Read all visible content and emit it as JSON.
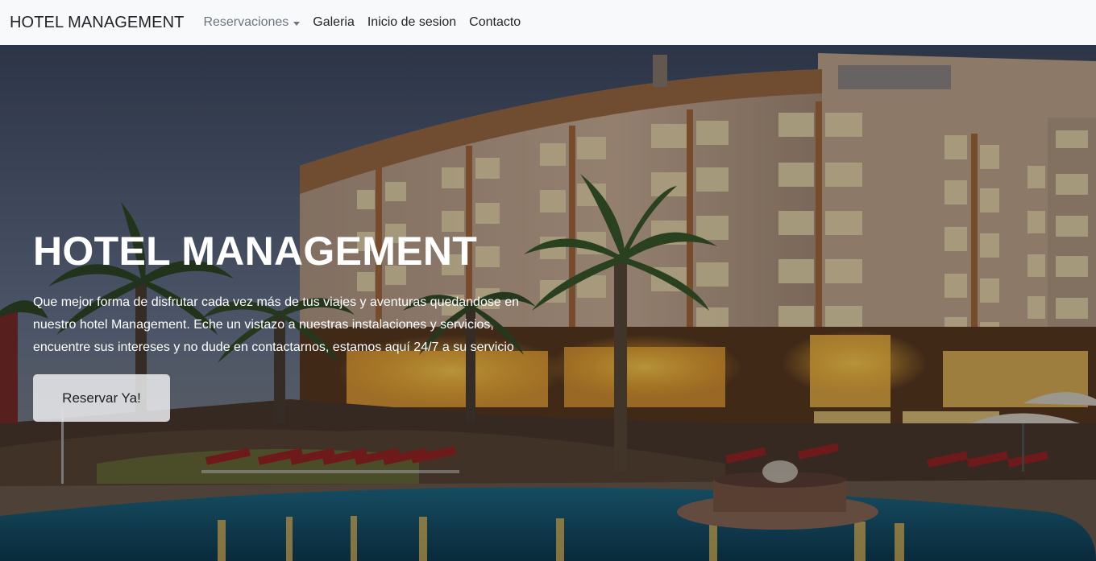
{
  "navbar": {
    "brand": "HOTEL MANAGEMENT",
    "items": [
      {
        "label": "Reservaciones",
        "dropdown": true
      },
      {
        "label": "Galeria"
      },
      {
        "label": "Inicio de sesion"
      },
      {
        "label": "Contacto"
      }
    ]
  },
  "hero": {
    "title": "HOTEL MANAGEMENT",
    "description": "Que mejor forma de disfrutar cada vez más de tus viajes y aventuras quedandose en nuestro hotel Management. Eche un vistazo a nuestras instalaciones y servicios, encuentre sus intereses y no dude en contactarnos, estamos aquí 24/7 a su servicio",
    "button_label": "Reservar Ya!"
  },
  "colors": {
    "navbar_bg": "#f8f9fa",
    "nav_text": "#212529",
    "nav_muted": "#6c757d",
    "hero_text": "#ffffff"
  }
}
